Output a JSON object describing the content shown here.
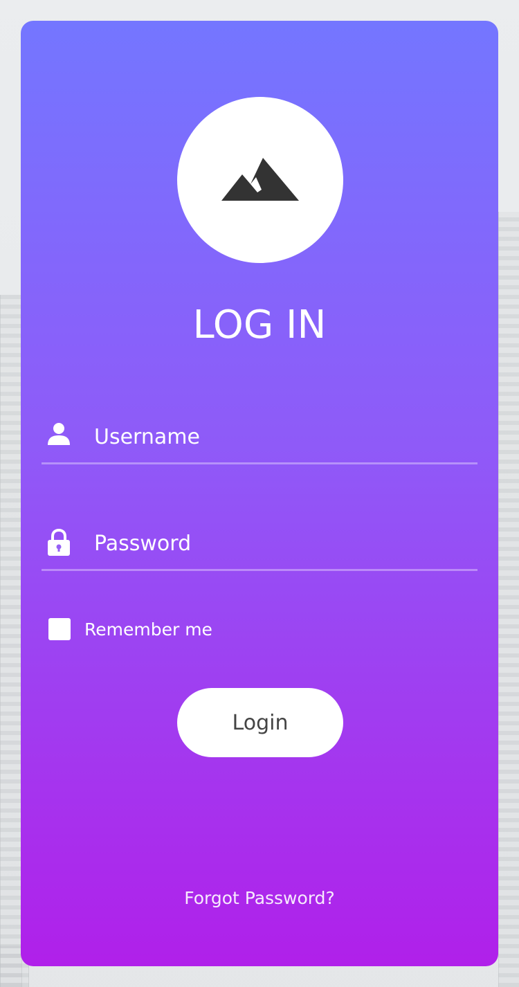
{
  "header": {
    "logo_icon": "mountain-icon",
    "title": "LOG IN"
  },
  "form": {
    "username": {
      "icon": "user-icon",
      "placeholder": "Username",
      "value": ""
    },
    "password": {
      "icon": "lock-icon",
      "placeholder": "Password",
      "value": ""
    },
    "remember": {
      "label": "Remember me",
      "checked": false
    },
    "login_label": "Login",
    "forgot_label": "Forgot Password?"
  },
  "colors": {
    "gradient_top": "#7476ff",
    "gradient_bottom": "#b020ea",
    "button_bg": "#ffffff",
    "button_text": "#444444",
    "logo_icon": "#333333"
  }
}
